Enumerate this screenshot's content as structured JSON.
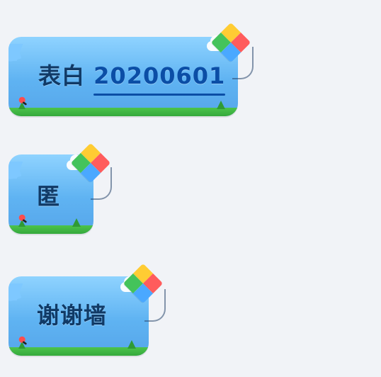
{
  "items": [
    {
      "label_prefix": "表白",
      "label_number": "20200601"
    },
    {
      "label": "匿"
    },
    {
      "label": "谢谢墙"
    }
  ]
}
